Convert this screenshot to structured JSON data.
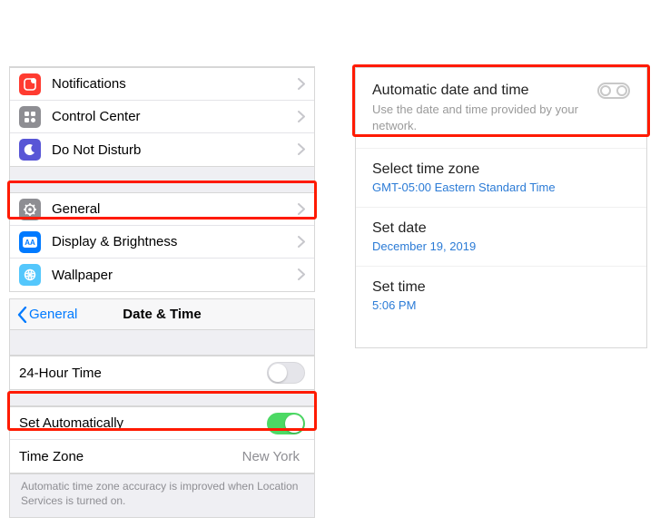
{
  "ios1": {
    "group1": [
      {
        "name": "notifications-row",
        "icon": "notifications-icon",
        "label": "Notifications"
      },
      {
        "name": "control-center-row",
        "icon": "control-center-icon",
        "label": "Control Center"
      },
      {
        "name": "do-not-disturb-row",
        "icon": "dnd-icon",
        "label": "Do Not Disturb"
      }
    ],
    "group2": [
      {
        "name": "general-row",
        "icon": "general-icon",
        "label": "General"
      },
      {
        "name": "display-brightness-row",
        "icon": "display-icon",
        "label": "Display & Brightness"
      },
      {
        "name": "wallpaper-row",
        "icon": "wallpaper-icon",
        "label": "Wallpaper"
      }
    ]
  },
  "ios2": {
    "back_label": "General",
    "title": "Date & Time",
    "row_24h": "24-Hour Time",
    "row_auto": "Set Automatically",
    "row_tz_label": "Time Zone",
    "row_tz_value": "New York",
    "footer": "Automatic time zone accuracy is improved when Location Services is turned on."
  },
  "android": {
    "auto_title": "Automatic date and time",
    "auto_sub": "Use the date and time provided by your network.",
    "tz_title": "Select time zone",
    "tz_value": "GMT-05:00 Eastern Standard Time",
    "date_title": "Set date",
    "date_value": "December 19, 2019",
    "time_title": "Set time",
    "time_value": "5:06 PM"
  },
  "icon_colors": {
    "notifications-icon": "#ff3b30",
    "control-center-icon": "#8e8e93",
    "dnd-icon": "#5856d6",
    "general-icon": "#8e8e93",
    "display-icon": "#007aff",
    "wallpaper-icon": "#54c7fc"
  }
}
